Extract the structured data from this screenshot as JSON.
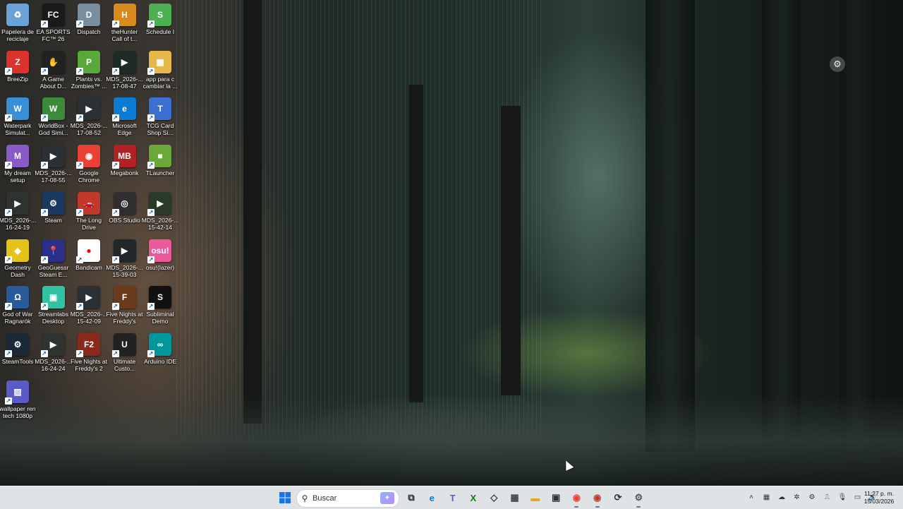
{
  "desktop": {
    "icons": [
      {
        "label": "Papelera de\nreciclaje",
        "icon": "recycle-bin-icon",
        "color": "#6aa2d8",
        "glyph": "♻"
      },
      {
        "label": "EA SPORTS\nFC™ 26",
        "icon": "ea-fc-icon",
        "color": "#1a1a1a",
        "glyph": "FC"
      },
      {
        "label": "Dispatch",
        "icon": "dispatch-icon",
        "color": "#7a8ea0",
        "glyph": "D"
      },
      {
        "label": "theHunter\nCall of t...",
        "icon": "thehunter-icon",
        "color": "#d98a1c",
        "glyph": "H"
      },
      {
        "label": "Schedule I",
        "icon": "schedule-i-icon",
        "color": "#4caf50",
        "glyph": "S"
      },
      {
        "label": "BreeZip",
        "icon": "breezip-icon",
        "color": "#d8342c",
        "glyph": "Z"
      },
      {
        "label": "A Game\nAbout D...",
        "icon": "a-game-about-icon",
        "color": "#222222",
        "glyph": "✋"
      },
      {
        "label": "Plants vs.\nZombies™ ...",
        "icon": "plants-vs-zombies-icon",
        "color": "#5aa83a",
        "glyph": "P"
      },
      {
        "label": "MDS_2026-...\n17-08-47",
        "icon": "video-thumbnail-icon",
        "color": "#1e2a26",
        "glyph": "▶"
      },
      {
        "label": "app para c\ncambiar la ...",
        "icon": "folder-icon",
        "color": "#e6b84a",
        "glyph": "▦"
      },
      {
        "label": "Waterpark\nSimulat...",
        "icon": "waterpark-icon",
        "color": "#3a8ed8",
        "glyph": "W"
      },
      {
        "label": "WorldBox -\nGod Simi...",
        "icon": "worldbox-icon",
        "color": "#3d8a3a",
        "glyph": "W"
      },
      {
        "label": "MDS_2026-...\n17-08-52",
        "icon": "video-thumbnail-icon",
        "color": "#2a3034",
        "glyph": "▶"
      },
      {
        "label": "Microsoft\nEdge",
        "icon": "edge-icon",
        "color": "#0c7bd4",
        "glyph": "e"
      },
      {
        "label": "TCG Card\nShop Si...",
        "icon": "tcg-card-shop-icon",
        "color": "#3c6fd0",
        "glyph": "T"
      },
      {
        "label": "My dream\nsetup",
        "icon": "my-dream-setup-icon",
        "color": "#8a5ac8",
        "glyph": "M"
      },
      {
        "label": "MDS_2026-...\n17-08-55",
        "icon": "video-thumbnail-icon",
        "color": "#2a3034",
        "glyph": "▶"
      },
      {
        "label": "Google\nChrome",
        "icon": "chrome-icon",
        "color": "#e94235",
        "glyph": "◉"
      },
      {
        "label": "Megabonk",
        "icon": "megabonk-icon",
        "color": "#b22222",
        "glyph": "MB"
      },
      {
        "label": "TLauncher",
        "icon": "tlauncher-icon",
        "color": "#6aa83a",
        "glyph": "■"
      },
      {
        "label": "MDS_2026-...\n16-24-19",
        "icon": "video-thumbnail-icon",
        "color": "#2e3330",
        "glyph": "▶"
      },
      {
        "label": "Steam",
        "icon": "steam-icon",
        "color": "#1b3a60",
        "glyph": "⚙"
      },
      {
        "label": "The Long\nDrive",
        "icon": "the-long-drive-icon",
        "color": "#c0392b",
        "glyph": "🚗"
      },
      {
        "label": "OBS Studio",
        "icon": "obs-studio-icon",
        "color": "#302e31",
        "glyph": "◎"
      },
      {
        "label": "MDS_2026-...\n15-42-14",
        "icon": "video-thumbnail-icon",
        "color": "#2a3a2a",
        "glyph": "▶"
      },
      {
        "label": "Geometry\nDash",
        "icon": "geometry-dash-icon",
        "color": "#e6c31a",
        "glyph": "◆"
      },
      {
        "label": "GeoGuessr\nSteam E...",
        "icon": "geoguessr-icon",
        "color": "#2b2f8a",
        "glyph": "📍"
      },
      {
        "label": "Bandicam",
        "icon": "bandicam-icon",
        "color": "#ffffff",
        "glyph": "●"
      },
      {
        "label": "MDS_2026-...\n15-39-03",
        "icon": "video-thumbnail-icon",
        "color": "#22282a",
        "glyph": "▶"
      },
      {
        "label": "osu!(lazer)",
        "icon": "osu-icon",
        "color": "#ea5a9a",
        "glyph": "osu!"
      },
      {
        "label": "God of War\nRagnarök",
        "icon": "god-of-war-icon",
        "color": "#2a5a9a",
        "glyph": "Ω"
      },
      {
        "label": "Streamlabs\nDesktop",
        "icon": "streamlabs-icon",
        "color": "#31c3a2",
        "glyph": "▣"
      },
      {
        "label": "MDS_2026-...\n15-42-09",
        "icon": "video-thumbnail-icon",
        "color": "#2a3034",
        "glyph": "▶"
      },
      {
        "label": "Five Nights at\nFreddy's",
        "icon": "fnaf-icon",
        "color": "#6a3a1a",
        "glyph": "F"
      },
      {
        "label": "Subliminal\nDemo",
        "icon": "subliminal-icon",
        "color": "#111111",
        "glyph": "S"
      },
      {
        "label": "SteamTools",
        "icon": "steamtools-icon",
        "color": "#1b2838",
        "glyph": "⚙"
      },
      {
        "label": "MDS_2026-...\n16-24-24",
        "icon": "video-thumbnail-icon",
        "color": "#2e3330",
        "glyph": "▶"
      },
      {
        "label": "Five Nights at\nFreddy's 2",
        "icon": "fnaf2-icon",
        "color": "#8a2a1a",
        "glyph": "F2"
      },
      {
        "label": "Ultimate\nCusto...",
        "icon": "ultimate-custom-night-icon",
        "color": "#222222",
        "glyph": "U"
      },
      {
        "label": "Arduino IDE",
        "icon": "arduino-icon",
        "color": "#00979c",
        "glyph": "∞"
      },
      {
        "label": "wallpaper ren\ntech 1080p",
        "icon": "wallpaper-image-icon",
        "color": "#5a5ac8",
        "glyph": "▨"
      }
    ]
  },
  "taskbar": {
    "search_placeholder": "Buscar",
    "pinned": [
      {
        "name": "task-view",
        "icon": "task-view-icon",
        "glyph": "⧉",
        "color": "#2b2b2b"
      },
      {
        "name": "edge",
        "icon": "edge-icon",
        "glyph": "e",
        "color": "#0c7bd4"
      },
      {
        "name": "teams",
        "icon": "teams-icon",
        "glyph": "T",
        "color": "#5b5fc7"
      },
      {
        "name": "xbox",
        "icon": "xbox-icon",
        "glyph": "X",
        "color": "#107c10"
      },
      {
        "name": "unity",
        "icon": "unity-icon",
        "glyph": "◇",
        "color": "#333333"
      },
      {
        "name": "widgets",
        "icon": "widgets-icon",
        "glyph": "▦",
        "color": "#444444"
      },
      {
        "name": "file-explorer",
        "icon": "file-explorer-icon",
        "glyph": "▬",
        "color": "#e6a817"
      },
      {
        "name": "microsoft-store",
        "icon": "store-icon",
        "glyph": "▣",
        "color": "#333333"
      },
      {
        "name": "chrome",
        "icon": "chrome-icon",
        "glyph": "◉",
        "color": "#e94235"
      },
      {
        "name": "chrome-profile",
        "icon": "chrome-profile-icon",
        "glyph": "◉",
        "color": "#c0392b"
      },
      {
        "name": "steamtools",
        "icon": "steamtools-icon",
        "glyph": "⟳",
        "color": "#333333"
      },
      {
        "name": "settings",
        "icon": "settings-icon",
        "glyph": "⚙",
        "color": "#555555"
      }
    ],
    "tray": [
      {
        "name": "overflow",
        "icon": "chevron-up-icon",
        "glyph": "˄"
      },
      {
        "name": "app1",
        "icon": "folder-tray-icon",
        "glyph": "▦"
      },
      {
        "name": "onedrive",
        "icon": "onedrive-icon",
        "glyph": "☁"
      },
      {
        "name": "app3",
        "icon": "app-tray-icon",
        "glyph": "✲"
      },
      {
        "name": "app4",
        "icon": "tray-app-icon",
        "glyph": "⚙"
      },
      {
        "name": "usb",
        "icon": "usb-icon",
        "glyph": "⎍"
      },
      {
        "name": "mic",
        "icon": "microphone-icon",
        "glyph": "🎙"
      },
      {
        "name": "network",
        "icon": "network-icon",
        "glyph": "▭"
      },
      {
        "name": "volume",
        "icon": "volume-icon",
        "glyph": "🔊"
      }
    ],
    "clock_time": "11:27 p. m.",
    "clock_date": "15/03/2026"
  }
}
